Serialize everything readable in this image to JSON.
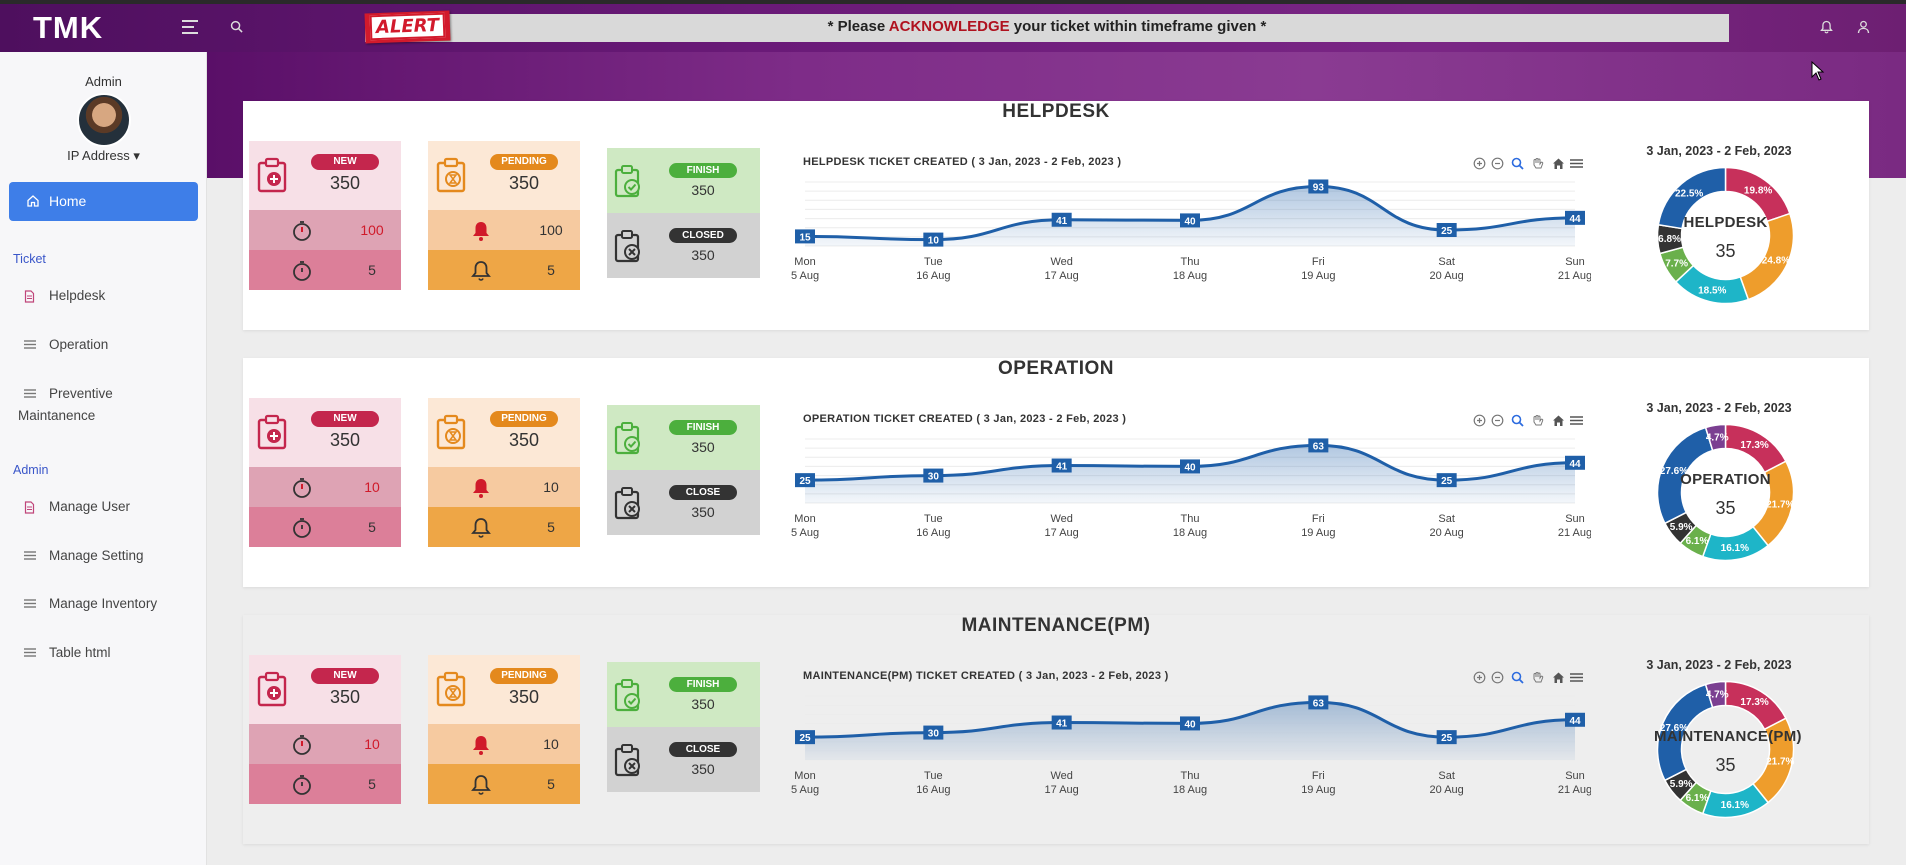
{
  "brand": "TMK",
  "alert": {
    "badge": "ALERT",
    "prefix": "* Please ",
    "highlight": "ACKNOWLEDGE",
    "suffix": " your ticket within timeframe given *"
  },
  "sidebar": {
    "user_name": "Admin",
    "ip_label": "IP Address ▾",
    "home": "Home",
    "sections": [
      {
        "title": "Ticket",
        "items": [
          "Helpdesk",
          "Operation",
          "Preventive",
          "Maintanence"
        ]
      },
      {
        "title": "Admin",
        "items": [
          "Manage User",
          "Manage Setting",
          "Manage Inventory",
          "Table html"
        ]
      }
    ]
  },
  "colors": {
    "accent": "#3e7ee8",
    "new": "#c4264d",
    "pending": "#e4891d",
    "finish": "#4caf3d",
    "line": "#1f5fa8",
    "donut": [
      "#c7305b",
      "#ee9d2c",
      "#1eb5c8",
      "#1a8fd1",
      "#6ab04c",
      "#333333",
      "#1f5fa8",
      "#7b3f91"
    ]
  },
  "panels": [
    {
      "key": "helpdesk",
      "title": "HELPDESK",
      "new": {
        "label": "NEW",
        "count": "350",
        "row1": "100",
        "row2": "5"
      },
      "pending": {
        "label": "PENDING",
        "count": "350",
        "row1": "100",
        "row2": "5"
      },
      "finish": {
        "label": "FINISH",
        "count": "350"
      },
      "closed": {
        "label": "CLOSED",
        "count": "350"
      },
      "chart_title": "HELPDESK TICKET CREATED ( 3 Jan, 2023 - 2 Feb, 2023 )",
      "donut_date": "3 Jan, 2023 - 2 Feb, 2023",
      "donut_label": "HELPDESK",
      "donut_count": "35"
    },
    {
      "key": "operation",
      "title": "OPERATION",
      "new": {
        "label": "NEW",
        "count": "350",
        "row1": "10",
        "row2": "5"
      },
      "pending": {
        "label": "PENDING",
        "count": "350",
        "row1": "10",
        "row2": "5"
      },
      "finish": {
        "label": "FINISH",
        "count": "350"
      },
      "closed": {
        "label": "CLOSE",
        "count": "350"
      },
      "chart_title": "OPERATION TICKET CREATED ( 3 Jan, 2023 - 2 Feb, 2023 )",
      "donut_date": "3 Jan, 2023 - 2 Feb, 2023",
      "donut_label": "OPERATION",
      "donut_count": "35"
    },
    {
      "key": "maintenance",
      "title": "MAINTENANCE(PM)",
      "new": {
        "label": "NEW",
        "count": "350",
        "row1": "10",
        "row2": "5"
      },
      "pending": {
        "label": "PENDING",
        "count": "350",
        "row1": "10",
        "row2": "5"
      },
      "finish": {
        "label": "FINISH",
        "count": "350"
      },
      "closed": {
        "label": "CLOSE",
        "count": "350"
      },
      "chart_title": "MAINTENANCE(PM) TICKET CREATED ( 3 Jan, 2023 - 2 Feb, 2023 )",
      "donut_date": "3 Jan, 2023 - 2 Feb, 2023",
      "donut_label": "MAINTENANCE(PM)",
      "donut_count": "35"
    }
  ],
  "chart_data": [
    {
      "type": "area",
      "categories": [
        "Mon|5 Aug",
        "Tue|16 Aug",
        "Wed|17 Aug",
        "Thu|18 Aug",
        "Fri|19 Aug",
        "Sat|20 Aug",
        "Sun|21 Aug"
      ],
      "series": [
        {
          "values": [
            15,
            10,
            41,
            40,
            93,
            25,
            44
          ]
        }
      ],
      "ylim": [
        0,
        100
      ]
    },
    {
      "type": "area",
      "categories": [
        "Mon|5 Aug",
        "Tue|16 Aug",
        "Wed|17 Aug",
        "Thu|18 Aug",
        "Fri|19 Aug",
        "Sat|20 Aug",
        "Sun|21 Aug"
      ],
      "series": [
        {
          "values": [
            25,
            30,
            41,
            40,
            63,
            25,
            44
          ]
        }
      ],
      "ylim": [
        0,
        70
      ]
    },
    {
      "type": "area",
      "categories": [
        "Mon|5 Aug",
        "Tue|16 Aug",
        "Wed|17 Aug",
        "Thu|18 Aug",
        "Fri|19 Aug",
        "Sat|20 Aug",
        "Sun|21 Aug"
      ],
      "series": [
        {
          "values": [
            25,
            30,
            41,
            40,
            63,
            25,
            44
          ]
        }
      ],
      "ylim": [
        0,
        70
      ]
    },
    {
      "type": "pie",
      "values": [
        19.8,
        24.8,
        18.5,
        7.7,
        6.8,
        22.5
      ],
      "labels": [
        "19.8%",
        "24.8%",
        "18.5%",
        "7.7%",
        "6.8%",
        "22.5%"
      ],
      "colors": [
        "#c7305b",
        "#ee9d2c",
        "#1eb5c8",
        "#6ab04c",
        "#333333",
        "#1f5fa8"
      ]
    },
    {
      "type": "pie",
      "values": [
        17.3,
        21.7,
        16.1,
        6.1,
        5.9,
        27.6,
        4.7
      ],
      "labels": [
        "17.3%",
        "21.7%",
        "16.1%",
        "6.1%",
        "5.9%",
        "27.6%",
        "4.7%"
      ],
      "colors": [
        "#c7305b",
        "#ee9d2c",
        "#1eb5c8",
        "#6ab04c",
        "#333333",
        "#1f5fa8",
        "#7b3f91"
      ]
    },
    {
      "type": "pie",
      "values": [
        17.3,
        21.7,
        16.1,
        6.1,
        5.9,
        27.6,
        4.7
      ],
      "labels": [
        "17.3%",
        "21.7%",
        "16.1%",
        "6.1%",
        "5.9%",
        "27.6%",
        "4.7%"
      ],
      "colors": [
        "#c7305b",
        "#ee9d2c",
        "#1eb5c8",
        "#6ab04c",
        "#333333",
        "#1f5fa8",
        "#7b3f91"
      ]
    }
  ]
}
